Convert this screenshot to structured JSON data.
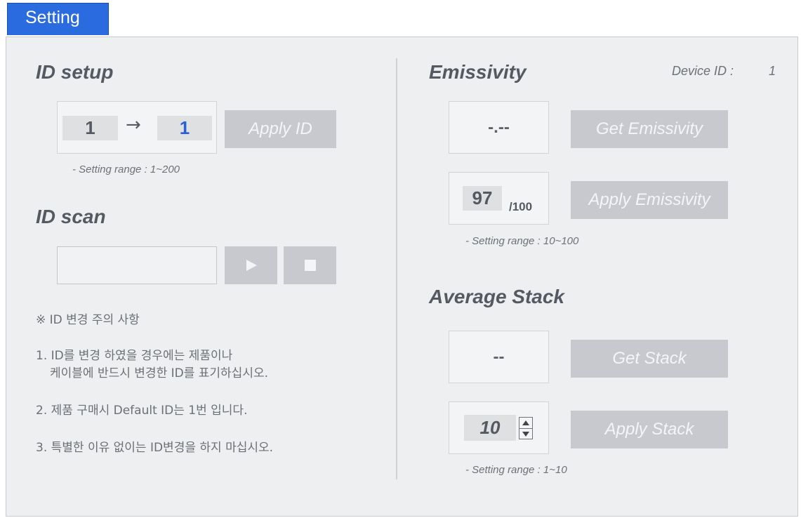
{
  "tab": {
    "label": "Setting"
  },
  "id_setup": {
    "title": "ID setup",
    "current_id": "1",
    "arrow": "→",
    "new_id": "1",
    "apply_button": "Apply ID",
    "range_note": "- Setting range : 1~200"
  },
  "id_scan": {
    "title": "ID scan",
    "scan_value": ""
  },
  "caution": {
    "title": "※ ID 변경 주의 사항",
    "item1_line1": "1. ID를 변경 하였을 경우에는 제품이나",
    "item1_line2": "케이블에 반드시 변경한 ID를 표기하십시오.",
    "item2": "2. 제품 구매시 Default ID는 1번 입니다.",
    "item3": "3. 특별한 이유 없이는 ID변경을 하지 마십시오."
  },
  "device": {
    "label": "Device ID :",
    "value": "1"
  },
  "emissivity": {
    "title": "Emissivity",
    "readout": "-.--",
    "get_button": "Get Emissivity",
    "input_value": "97",
    "suffix": "/100",
    "apply_button": "Apply Emissivity",
    "range_note": "- Setting range : 10~100"
  },
  "stack": {
    "title": "Average Stack",
    "readout": "--",
    "get_button": "Get Stack",
    "input_value": "10",
    "apply_button": "Apply Stack",
    "range_note": "- Setting range : 1~10"
  },
  "colors": {
    "tab": "#2b6be0",
    "panel": "#eeeff1",
    "button": "#c7c9cf",
    "new_id_text": "#2b5fd9"
  }
}
